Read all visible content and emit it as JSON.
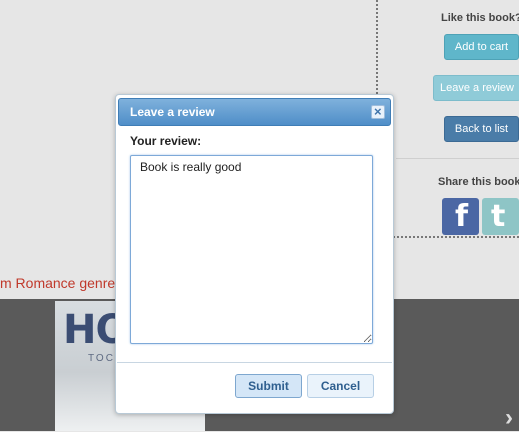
{
  "side_panel": {
    "like_label": "Like this book?",
    "add_to_cart": "Add to cart",
    "leave_review": "Leave a review",
    "back_to_list": "Back to list",
    "share_label": "Share this book",
    "facebook_glyph": "f",
    "twitter_glyph": "t"
  },
  "genre_heading": "m Romance genre",
  "book": {
    "title_fragment": "HOP",
    "subtitle_fragment": "TOCAN"
  },
  "modal": {
    "title": "Leave a review",
    "close_glyph": "×",
    "review_label": "Your review:",
    "review_value": "Book is really good",
    "submit": "Submit",
    "cancel": "Cancel"
  },
  "icons": {
    "close": "close-icon",
    "facebook": "facebook-icon",
    "twitter": "twitter-icon",
    "next": "chevron-right-icon"
  },
  "colors": {
    "accent": "#4f8ec8",
    "genre_text": "#c0392b",
    "add_to_cart_button": "#5fb6ca",
    "back_button": "#4a7ca8"
  }
}
